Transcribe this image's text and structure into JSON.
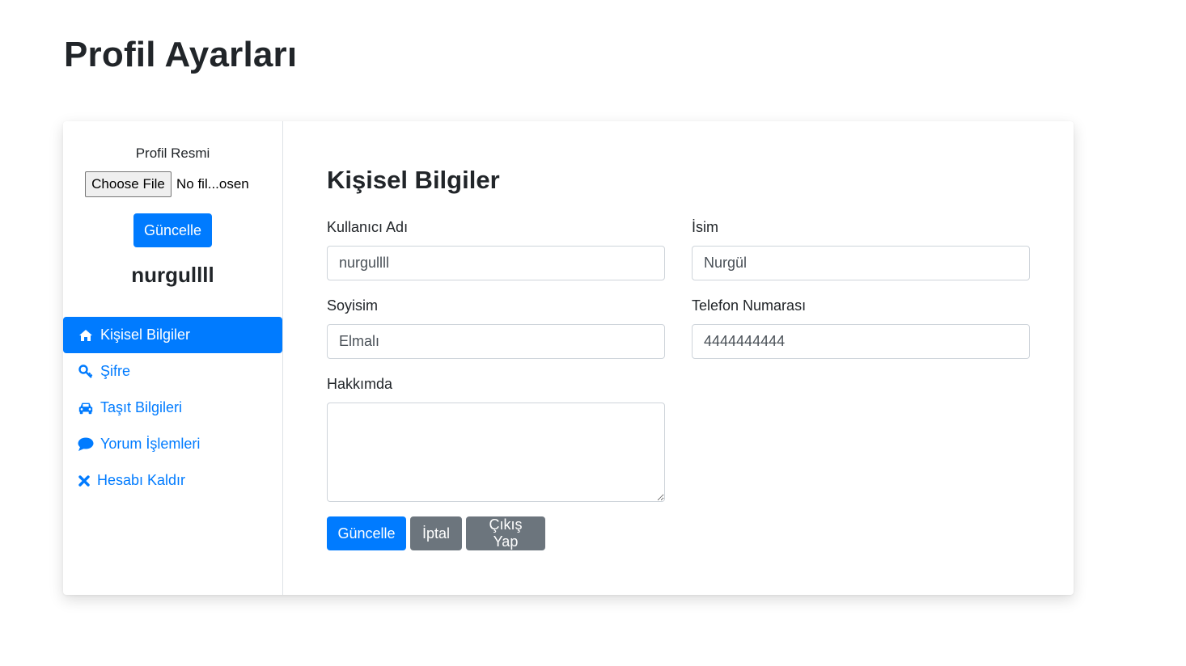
{
  "page": {
    "title": "Profil Ayarları"
  },
  "sidebar": {
    "profile_picture_label": "Profil Resmi",
    "file_button_label": "Choose File",
    "file_status": "No fil...osen",
    "update_button_label": "Güncelle",
    "username": "nurgullll",
    "nav": [
      {
        "label": "Kişisel Bilgiler",
        "icon": "home-icon",
        "active": true
      },
      {
        "label": "Şifre",
        "icon": "key-icon",
        "active": false
      },
      {
        "label": "Taşıt Bilgileri",
        "icon": "car-icon",
        "active": false
      },
      {
        "label": "Yorum İşlemleri",
        "icon": "comment-icon",
        "active": false
      },
      {
        "label": "Hesabı Kaldır",
        "icon": "close-icon",
        "active": false
      }
    ]
  },
  "main": {
    "section_title": "Kişisel Bilgiler",
    "fields": {
      "username": {
        "label": "Kullanıcı Adı",
        "value": "nurgullll"
      },
      "name": {
        "label": "İsim",
        "value": "Nurgül"
      },
      "surname": {
        "label": "Soyisim",
        "value": "Elmalı"
      },
      "phone": {
        "label": "Telefon Numarası",
        "value": "4444444444"
      },
      "about": {
        "label": "Hakkımda",
        "value": ""
      }
    },
    "buttons": {
      "update": "Güncelle",
      "cancel": "İptal",
      "logout": "Çıkış Yap"
    }
  },
  "colors": {
    "primary": "#007bff",
    "secondary": "#6c757d",
    "text": "#212529",
    "border": "#ced4da"
  }
}
